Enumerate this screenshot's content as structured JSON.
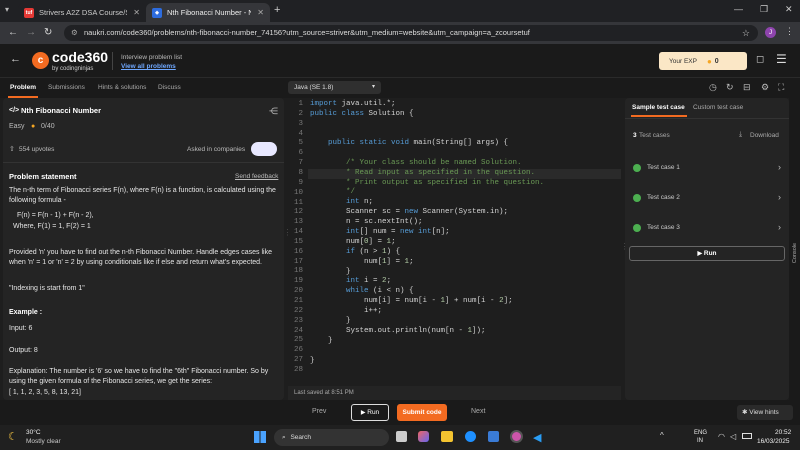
{
  "browser": {
    "tabs": [
      {
        "label": "Strivers A2Z DSA Course/Sheet",
        "favicon": "tuf"
      },
      {
        "label": "Nth Fibonacci Number - Naukri",
        "active": true
      }
    ],
    "url": "naukri.com/code360/problems/nth-fibonacci-number_74156?utm_source=striver&utm_medium=website&utm_campaign=a_zcoursetuf",
    "profile_initial": "J"
  },
  "site": {
    "logo_text": "code360",
    "logo_sub": "by codingninjas",
    "interview_list_label": "Interview problem list",
    "interview_list_link": "View all problems",
    "exp_label": "Your EXP",
    "exp_value": "0"
  },
  "problem_tabs": [
    "Problem",
    "Submissions",
    "Hints & solutions",
    "Discuss"
  ],
  "language": "Java (SE 1.8)",
  "problem": {
    "title": "Nth Fibonacci Number",
    "difficulty": "Easy",
    "score": "0/40",
    "upvotes": "554 upvotes",
    "asked_in": "Asked in companies",
    "statement_heading": "Problem statement",
    "send_feedback": "Send feedback",
    "para1": "The n-th term of Fibonacci series F(n), where F(n) is a function, is calculated using the following formula -",
    "formula1": "F(n) = F(n - 1) + F(n - 2),",
    "formula2": "Where, F(1) = 1, F(2) = 1",
    "para2": "Provided 'n' you have to find out the n-th Fibonacci Number. Handle edges cases like when 'n' = 1 or 'n' = 2 by using conditionals like if else and return what's expected.",
    "note": "\"Indexing is start from 1\"",
    "example_heading": "Example :",
    "input": "Input: 6",
    "output": "Output: 8",
    "explanation": "Explanation: The number is '6' so we have to find the \"6th\" Fibonacci number. So by using the given formula of the Fibonacci series, we get the series:",
    "series": "[ 1, 1, 2, 3, 5, 8, 13, 21]"
  },
  "editor": {
    "line_numbers": [
      "1",
      "2",
      "3",
      "4",
      "5",
      "6",
      "7",
      "8",
      "9",
      "10",
      "11",
      "12",
      "13",
      "14",
      "15",
      "16",
      "17",
      "18",
      "19",
      "20",
      "21",
      "22",
      "23",
      "24",
      "25",
      "26",
      "27",
      "28"
    ],
    "last_saved": "Last saved at 8:51 PM"
  },
  "right_panel": {
    "tab_sample": "Sample test case",
    "tab_custom": "Custom test case",
    "test_count": "3",
    "test_label": "Test cases",
    "download": "Download",
    "cases": [
      "Test case 1",
      "Test case 2",
      "Test case 3"
    ],
    "run": "Run",
    "console": "Console"
  },
  "actions": {
    "prev": "Prev",
    "run": "Run",
    "submit": "Submit code",
    "next": "Next",
    "view_hints": "View hints"
  },
  "taskbar": {
    "weather_temp": "30°C",
    "weather_desc": "Mostly clear",
    "search": "Search",
    "lang": "ENG",
    "region": "IN",
    "time": "20:52",
    "date": "16/03/2025"
  }
}
